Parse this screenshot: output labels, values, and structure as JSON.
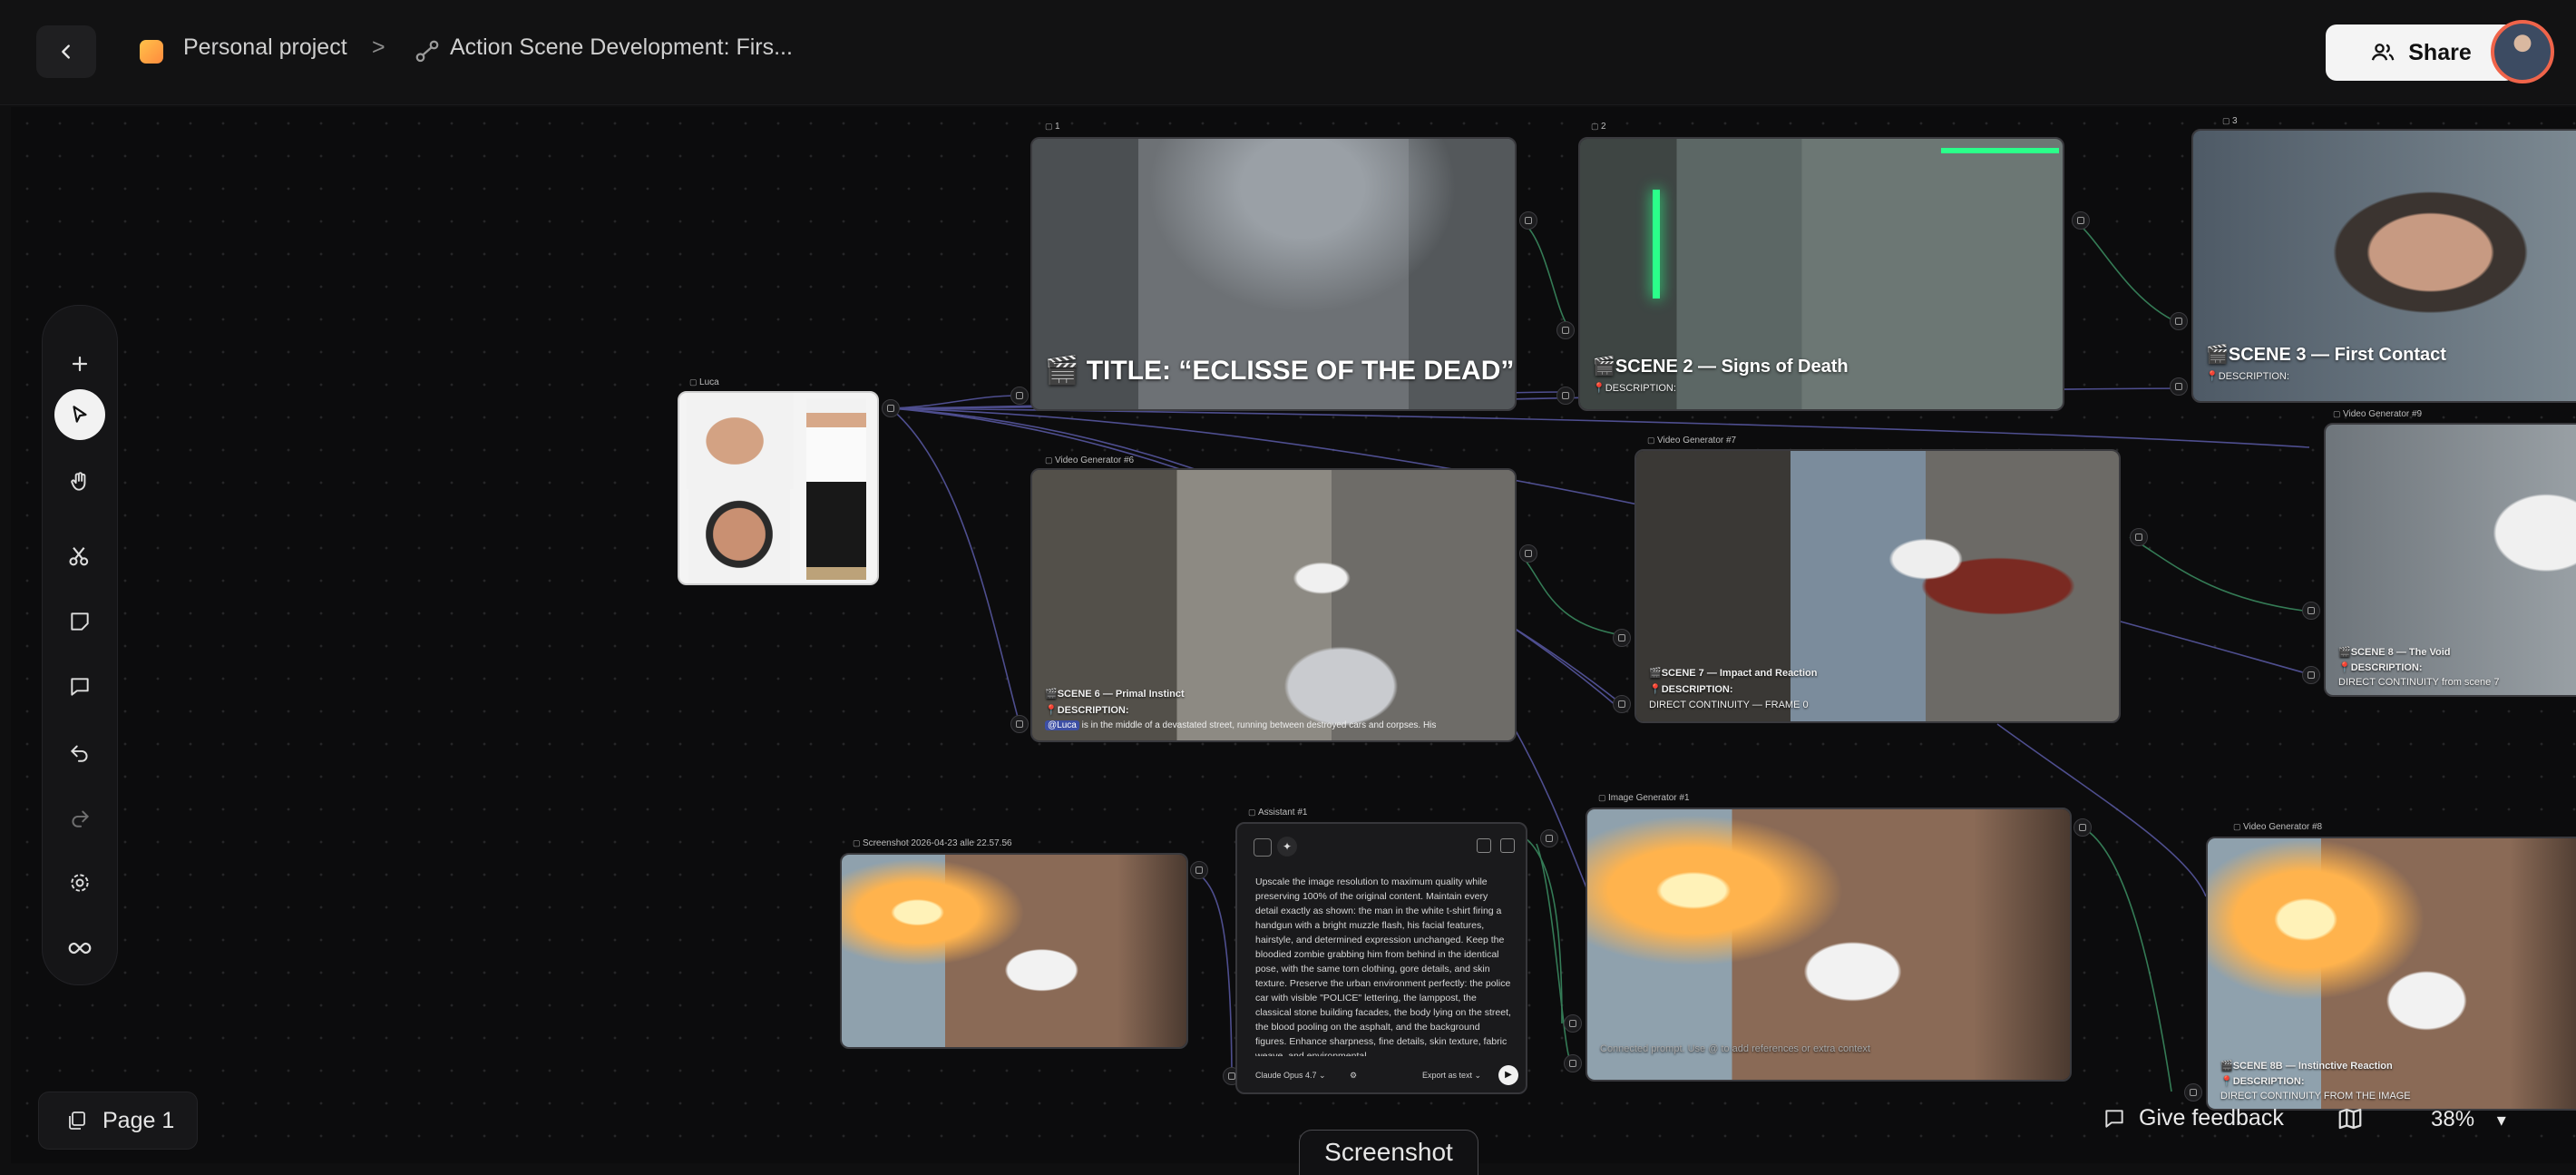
{
  "header": {
    "project": "Personal project",
    "separator": ">",
    "scene_title": "Action Scene Development: Firs...",
    "share_label": "Share"
  },
  "toolbar": {
    "tools": [
      "add-icon",
      "pointer-icon",
      "hand-icon",
      "scissors-icon",
      "sticky-note-icon",
      "comment-icon",
      "undo-icon",
      "redo-icon",
      "settings-icon",
      "infinity-icon"
    ]
  },
  "nodes": {
    "luca": {
      "label": "Luca"
    },
    "video1": {
      "label": "1",
      "title": "🎬 TITLE: “ECLISSE OF THE DEAD”"
    },
    "video2": {
      "label": "2",
      "title": "🎬SCENE 2 — Signs of Death",
      "desc": "📍DESCRIPTION:"
    },
    "video3": {
      "label": "3",
      "title": "🎬SCENE 3 — First Contact",
      "desc": "📍DESCRIPTION:"
    },
    "gen6": {
      "label": "Video Generator #6",
      "title": "🎬SCENE 6 — Primal Instinct",
      "desc": "📍DESCRIPTION:",
      "text": "is in the middle of a devastated street, running between destroyed cars and corpses. His",
      "tag": "@Luca"
    },
    "gen7": {
      "label": "Video Generator #7",
      "title": "🎬SCENE 7 — Impact and Reaction",
      "desc": "📍DESCRIPTION:",
      "text": "DIRECT CONTINUITY — FRAME 0"
    },
    "gen9": {
      "label": "Video Generator #9",
      "title": "🎬SCENE 8 — The Void",
      "desc": "📍DESCRIPTION:",
      "text": "DIRECT CONTINUITY from scene 7"
    },
    "screenshot": {
      "label": "Screenshot 2026-04-23 alle 22.57.56"
    },
    "assistant": {
      "label": "Assistant #1",
      "text": "Upscale the image resolution to maximum quality while preserving 100% of the original content. Maintain every detail exactly as shown: the man in the white t-shirt firing a handgun with a bright muzzle flash, his facial features, hairstyle, and determined expression unchanged. Keep the bloodied zombie grabbing him from behind in the identical pose, with the same torn clothing, gore details, and skin texture. Preserve the urban environment perfectly: the police car with visible \"POLICE\" lettering, the lamppost, the classical stone building facades, the body lying on the street, the blood pooling on the asphalt, and the background figures. Enhance sharpness, fine details, skin texture, fabric weave, and environmental",
      "model": "Claude Opus 4.7",
      "export": "Export as text"
    },
    "imagegen": {
      "label": "Image Generator #1",
      "placeholder": "Connected prompt. Use @ to add references or extra context"
    },
    "gen8": {
      "label": "Video Generator #8",
      "title": "🎬SCENE 8B — Instinctive Reaction",
      "desc": "📍DESCRIPTION:",
      "text": "DIRECT CONTINUITY FROM THE IMAGE"
    }
  },
  "footer": {
    "page_label": "Page 1",
    "feedback_label": "Give feedback",
    "zoom": "38%",
    "tab_label": "Screenshot"
  }
}
